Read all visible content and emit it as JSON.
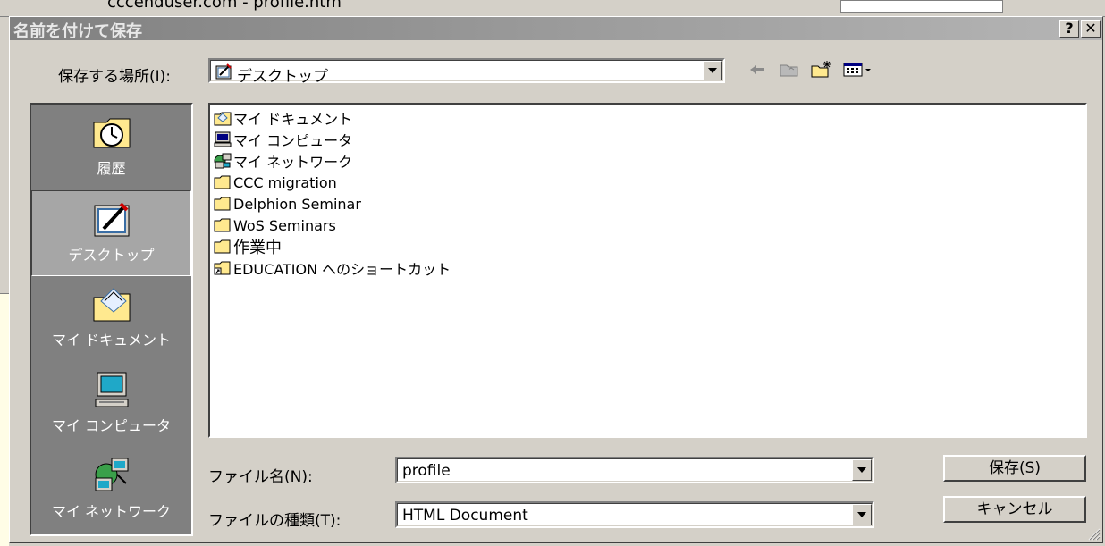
{
  "background": {
    "url_text": "cccenduser.com - profile.htm"
  },
  "dialog": {
    "title": "名前を付けて保存",
    "help_button": "?",
    "close_button": "✕"
  },
  "location": {
    "label": "保存する場所(I):",
    "value": "デスクトップ"
  },
  "places": [
    {
      "label": "履歴",
      "icon": "history-icon"
    },
    {
      "label": "デスクトップ",
      "icon": "desktop-icon",
      "selected": true
    },
    {
      "label": "マイ ドキュメント",
      "icon": "my-documents-icon"
    },
    {
      "label": "マイ コンピュータ",
      "icon": "my-computer-icon"
    },
    {
      "label": "マイ ネットワーク",
      "icon": "my-network-icon"
    }
  ],
  "files": [
    {
      "name": "マイ ドキュメント",
      "icon": "my-documents-icon"
    },
    {
      "name": "マイ コンピュータ",
      "icon": "computer-icon"
    },
    {
      "name": "マイ ネットワーク",
      "icon": "network-icon"
    },
    {
      "name": "CCC migration",
      "icon": "folder-icon"
    },
    {
      "name": "Delphion Seminar",
      "icon": "folder-icon"
    },
    {
      "name": "WoS Seminars",
      "icon": "folder-icon"
    },
    {
      "name": "作業中",
      "icon": "folder-icon"
    },
    {
      "name": "EDUCATION へのショートカット",
      "icon": "folder-shortcut-icon"
    }
  ],
  "filename": {
    "label": "ファイル名(N):",
    "value": "profile"
  },
  "filetype": {
    "label": "ファイルの種類(T):",
    "value": "HTML Document"
  },
  "buttons": {
    "save": "保存(S)",
    "cancel": "キャンセル"
  },
  "colors": {
    "title_gradient_start": "#808080",
    "title_gradient_end": "#b5b5b5",
    "face": "#d4d0c8",
    "folder": "#ffe98f"
  }
}
